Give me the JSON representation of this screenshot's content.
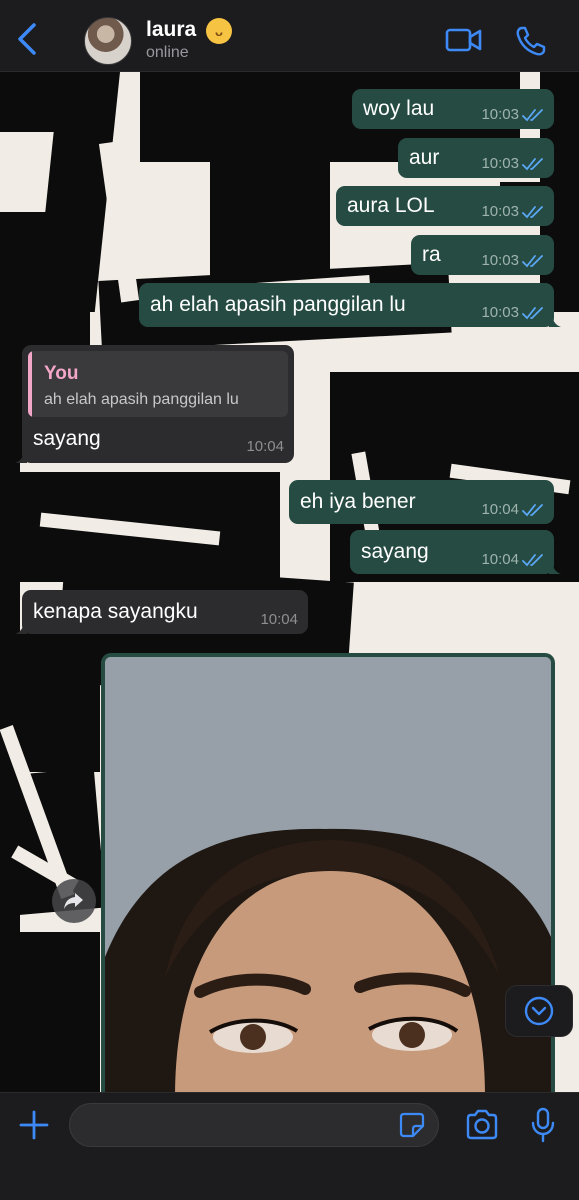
{
  "header": {
    "contact_name": "laura",
    "status": "online"
  },
  "messages": [
    {
      "direction": "out",
      "text": "woy lau",
      "time": "10:03",
      "read": true
    },
    {
      "direction": "out",
      "text": "aur",
      "time": "10:03",
      "read": true
    },
    {
      "direction": "out",
      "text": "aura LOL",
      "time": "10:03",
      "read": true
    },
    {
      "direction": "out",
      "text": "ra",
      "time": "10:03",
      "read": true
    },
    {
      "direction": "out",
      "text": "ah elah apasih panggilan lu",
      "time": "10:03",
      "read": true
    },
    {
      "direction": "in",
      "text": "sayang",
      "time": "10:04",
      "reply_to": {
        "author": "You",
        "text": "ah elah apasih panggilan lu"
      }
    },
    {
      "direction": "out",
      "text": "eh iya bener",
      "time": "10:04",
      "read": true
    },
    {
      "direction": "out",
      "text": "sayang",
      "time": "10:04",
      "read": true
    },
    {
      "direction": "in",
      "text": "kenapa sayangku",
      "time": "10:04"
    },
    {
      "direction": "out",
      "type": "image"
    }
  ],
  "input": {
    "placeholder": "",
    "value": ""
  },
  "icons": {
    "back": "chevron-left-icon",
    "video": "video-camera-icon",
    "call": "phone-icon",
    "forward": "forward-arrow-icon",
    "scroll": "chevron-down-circle-icon",
    "plus": "plus-icon",
    "sticker": "sticker-icon",
    "camera": "camera-icon",
    "mic": "microphone-icon",
    "read_receipt": "double-check-icon"
  },
  "colors": {
    "accent": "#3d8af7",
    "outgoing_bubble": "#264b43",
    "incoming_bubble": "#2c2c2e",
    "reply_author": "#f2a6c8",
    "read_tick": "#5aa8f5"
  }
}
